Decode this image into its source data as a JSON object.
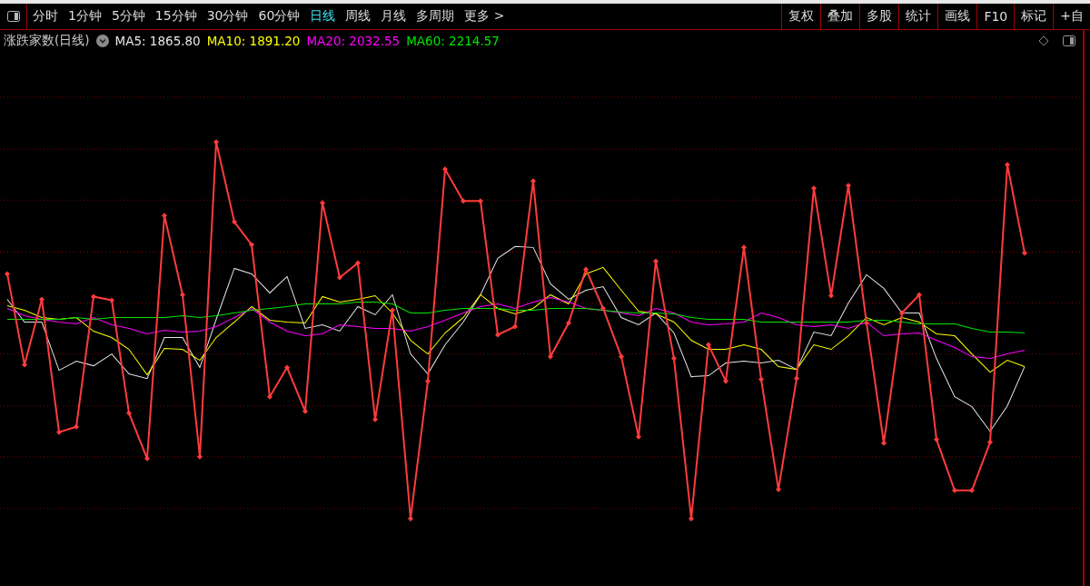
{
  "toolbar": {
    "periods": [
      {
        "label": "分时",
        "selected": false
      },
      {
        "label": "1分钟",
        "selected": false
      },
      {
        "label": "5分钟",
        "selected": false
      },
      {
        "label": "15分钟",
        "selected": false
      },
      {
        "label": "30分钟",
        "selected": false
      },
      {
        "label": "60分钟",
        "selected": false
      },
      {
        "label": "日线",
        "selected": true
      },
      {
        "label": "周线",
        "selected": false
      },
      {
        "label": "月线",
        "selected": false
      },
      {
        "label": "多周期",
        "selected": false
      }
    ],
    "more": {
      "label": "更多",
      "icon": ">"
    },
    "buttons": [
      "复权",
      "叠加",
      "多股",
      "统计",
      "画线",
      "F10",
      "标记",
      "+自"
    ]
  },
  "legend": {
    "title": "涨跌家数(日线)",
    "indicators": [
      {
        "label": "MA5: 1865.80",
        "color": "#e6e6e6"
      },
      {
        "label": "MA10: 1891.20",
        "color": "#ffff00"
      },
      {
        "label": "MA20: 2032.55",
        "color": "#ff00ff"
      },
      {
        "label": "MA60: 2214.57",
        "color": "#00e600"
      }
    ]
  }
}
